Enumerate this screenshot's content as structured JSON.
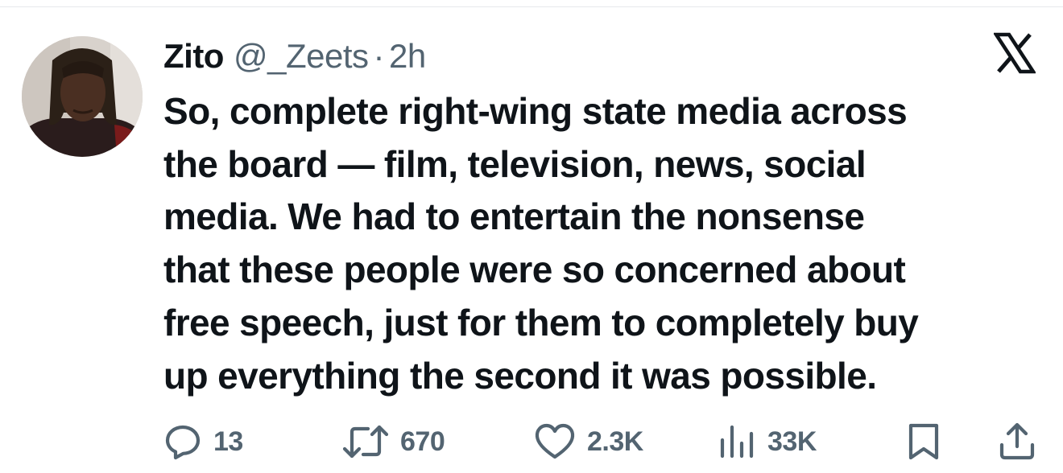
{
  "tweet": {
    "display_name": "Zito",
    "handle": "@_Zeets",
    "separator": "·",
    "time": "2h",
    "text": "So, complete right-wing state media across\nthe board — film, television, news, social\nmedia. We had to entertain the nonsense\nthat these people were so concerned about\nfree speech, just for them to completely buy\nup everything the second it was possible.",
    "platform_icon": "x-logo-icon",
    "avatar_icon": "avatar"
  },
  "actions": {
    "replies": {
      "icon": "reply-icon",
      "count": "13"
    },
    "reposts": {
      "icon": "repost-icon",
      "count": "670"
    },
    "likes": {
      "icon": "heart-icon",
      "count": "2.3K"
    },
    "views": {
      "icon": "views-icon",
      "count": "33K"
    },
    "bookmark": {
      "icon": "bookmark-icon"
    },
    "share": {
      "icon": "share-icon"
    }
  },
  "colors": {
    "text": "#0f1419",
    "muted": "#536471",
    "divider": "#e6e9ec"
  }
}
